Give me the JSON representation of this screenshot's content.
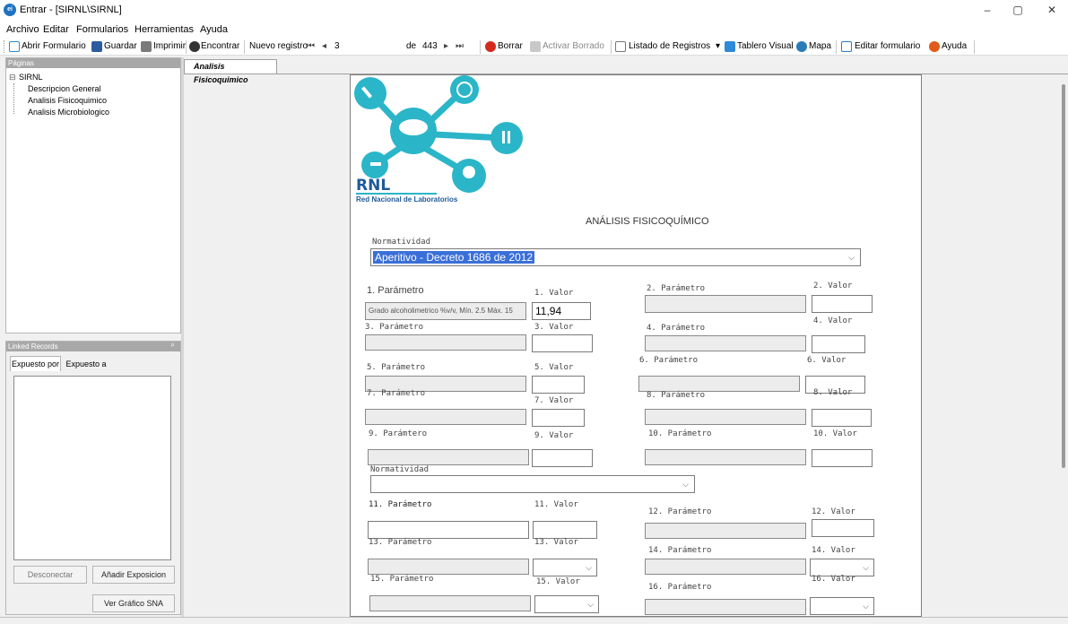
{
  "window": {
    "title": "Entrar - [SIRNL\\SIRNL]",
    "app_icon": "ei",
    "minimize": "–",
    "restore": "▢",
    "close": "✕"
  },
  "menu": [
    "Archivo",
    "Editar",
    "Formularios",
    "Herramientas",
    "Ayuda"
  ],
  "toolbar": {
    "open": "Abrir Formulario",
    "save": "Guardar",
    "print": "Imprimir",
    "find": "Encontrar",
    "new_record": "Nuevo registro",
    "record_current": "3",
    "record_of": "de",
    "record_total": "443",
    "delete": "Borrar",
    "undelete": "Activar Borrado",
    "list": "Listado de Registros",
    "dashboard": "Tablero Visual",
    "map": "Mapa",
    "edit_form": "Editar formulario",
    "help": "Ayuda",
    "nav_first": "⏮",
    "nav_prev": "◂",
    "nav_next": "▸",
    "nav_last": "⏭",
    "list_dropdown": "▾"
  },
  "pages_panel": {
    "header": "Páginas",
    "root": "SIRNL",
    "items": [
      "Descripcion General",
      "Analisis Fisicoquimico",
      "Analisis Microbiologico"
    ]
  },
  "linked_panel": {
    "header": "Linked Records",
    "pin": "ᵖ",
    "tabs": [
      "Expuesto por",
      "Expuesto a"
    ],
    "disconnect": "Desconectar",
    "add": "Añadir Exposicion",
    "graph": "Ver Gráfico SNA"
  },
  "doc_tab": "Analisis Fisicoquimico",
  "logo": {
    "acronym": "RNL",
    "name": "Red Nacional de Laboratorios"
  },
  "form": {
    "title": "ANÁLISIS FISICOQUÍMICO",
    "norm_label": "Normatividad",
    "norm_value": "Aperitivo - Decreto 1686 de 2012",
    "norm2_label": "Normatividad",
    "p1_label": "1. Parámetro",
    "p1_value": "Grado alcoholimetrico %v/v, Mín. 2.5 Máx. 15",
    "v1_label": "1. Valor",
    "v1_value": "11,94",
    "p2_label": "2. Parámetro",
    "v2_label": "2. Valor",
    "p3_label": "3. Parámetro",
    "v3_label": "3. Valor",
    "p4_label": "4. Parámetro",
    "v4_label": "4. Valor",
    "p5_label": "5. Parámetro",
    "v5_label": "5. Valor",
    "p6_label": "6. Parámetro",
    "v6_label": "6. Valor",
    "p7_label": "7. Parámetro",
    "v7_label": "7. Valor",
    "p8_label": "8. Parámetro",
    "v8_label": "8. Valor",
    "p9_label": "9. Parámtero",
    "v9_label": "9. Valor",
    "p10_label": "10. Parámetro",
    "v10_label": "10. Valor",
    "p11_label": "11. Parámetro",
    "v11_label": "11. Valor",
    "p12_label": "12. Parámetro",
    "v12_label": "12. Valor",
    "p13_label": "13. Parámetro",
    "v13_label": "13. Valor",
    "p14_label": "14. Parámetro",
    "v14_label": "14. Valor",
    "p15_label": "15. Parámetro",
    "v15_label": "15. Valor",
    "p16_label": "16. Parámetro",
    "v16_label": "16. Valor"
  },
  "colors": {
    "logo_teal": "#2bb5c8",
    "logo_blue": "#1e5a9a",
    "selection": "#3a6fd8"
  }
}
